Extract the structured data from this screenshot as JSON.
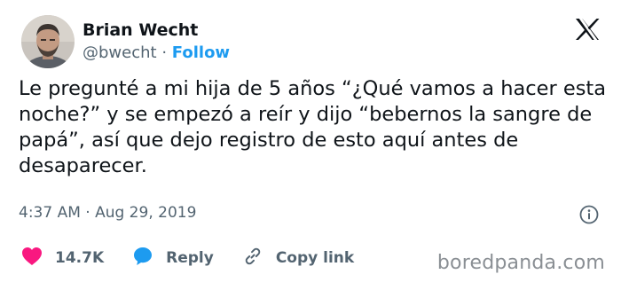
{
  "author": {
    "display_name": "Brian Wecht",
    "handle": "@bwecht",
    "separator": "·",
    "follow_label": "Follow"
  },
  "tweet": {
    "text": "Le pregunté a mi hija de 5 años “¿Qué vamos a hacer esta noche?” y se empezó a reír y dijo “bebernos la sangre de papá”, así que dejo registro de esto aquí antes de desaparecer.",
    "timestamp": "4:37 AM · Aug 29, 2019"
  },
  "actions": {
    "like_count": "14.7K",
    "reply_label": "Reply",
    "copy_link_label": "Copy link"
  },
  "icons": {
    "platform_logo": "x-logo-icon",
    "info": "info-icon",
    "like": "heart-icon",
    "reply": "speech-bubble-icon",
    "copy_link": "link-icon"
  },
  "colors": {
    "accent": "#1d9bf0",
    "like": "#f91880",
    "secondary_text": "#536471",
    "primary_text": "#0f1419"
  },
  "watermark": "boredpanda.com"
}
